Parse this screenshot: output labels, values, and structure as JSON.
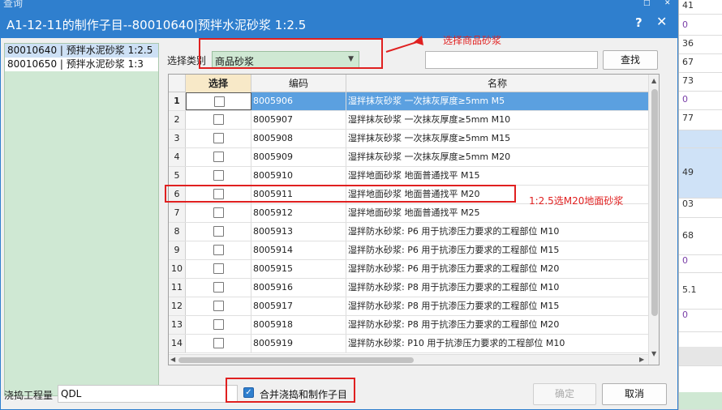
{
  "dialog": {
    "title": "A1-12-11的制作子目--80010640|预拌水泥砂浆 1:2.5",
    "help_icon": "?",
    "close_icon": "✕"
  },
  "background_window": {
    "title": "查询",
    "top_icons": [
      "□",
      "✕"
    ],
    "column_cells": [
      "41",
      "0",
      "36",
      "67",
      "73",
      "0",
      "77",
      "",
      "49",
      "03",
      "68",
      "0",
      "5.1",
      "0"
    ]
  },
  "left_list": {
    "items": [
      {
        "label": "80010640 | 预拌水泥砂浆 1:2.5",
        "selected": true
      },
      {
        "label": "80010650 | 预拌水泥砂浆 1:3",
        "selected": false
      }
    ]
  },
  "filter": {
    "category_label": "选择类别",
    "category_value": "商品砂浆",
    "search_value": "",
    "find_button": "查找"
  },
  "grid": {
    "columns": [
      "选择",
      "编码",
      "名称"
    ],
    "rows": [
      {
        "idx": "1",
        "code": "8005906",
        "name": "湿拌抹灰砂浆 一次抹灰厚度≥5mm M5",
        "active": true
      },
      {
        "idx": "2",
        "code": "8005907",
        "name": "湿拌抹灰砂浆 一次抹灰厚度≥5mm M10"
      },
      {
        "idx": "3",
        "code": "8005908",
        "name": "湿拌抹灰砂浆 一次抹灰厚度≥5mm M15"
      },
      {
        "idx": "4",
        "code": "8005909",
        "name": "湿拌抹灰砂浆 一次抹灰厚度≥5mm M20"
      },
      {
        "idx": "5",
        "code": "8005910",
        "name": "湿拌地面砂浆 地面普通找平 M15"
      },
      {
        "idx": "6",
        "code": "8005911",
        "name": "湿拌地面砂浆 地面普通找平 M20"
      },
      {
        "idx": "7",
        "code": "8005912",
        "name": "湿拌地面砂浆 地面普通找平 M25"
      },
      {
        "idx": "8",
        "code": "8005913",
        "name": "湿拌防水砂浆: P6 用于抗渗压力要求的工程部位 M10"
      },
      {
        "idx": "9",
        "code": "8005914",
        "name": "湿拌防水砂浆: P6 用于抗渗压力要求的工程部位 M15"
      },
      {
        "idx": "10",
        "code": "8005915",
        "name": "湿拌防水砂浆: P6 用于抗渗压力要求的工程部位 M20"
      },
      {
        "idx": "11",
        "code": "8005916",
        "name": "湿拌防水砂浆: P8 用于抗渗压力要求的工程部位 M10"
      },
      {
        "idx": "12",
        "code": "8005917",
        "name": "湿拌防水砂浆: P8 用于抗渗压力要求的工程部位 M15"
      },
      {
        "idx": "13",
        "code": "8005918",
        "name": "湿拌防水砂浆: P8 用于抗渗压力要求的工程部位 M20"
      },
      {
        "idx": "14",
        "code": "8005919",
        "name": "湿拌防水砂浆: P10 用于抗渗压力要求的工程部位 M10"
      }
    ]
  },
  "bottom": {
    "quantity_label": "浇捣工程量",
    "quantity_value": "QDL",
    "merge_label": "合并浇捣和制作子目",
    "merge_checked": true,
    "confirm_button": "确定",
    "cancel_button": "取消"
  },
  "annotations": {
    "category_hint": "选择商品砂浆",
    "row_hint": "1:2.5选M20地面砂浆"
  },
  "colors": {
    "title_bar": "#2f7fce",
    "annotation_red": "#e02020",
    "row_highlight": "#5ba0e0",
    "left_panel_bg": "#cfe8d3",
    "select_header": "#f8e9c8"
  }
}
